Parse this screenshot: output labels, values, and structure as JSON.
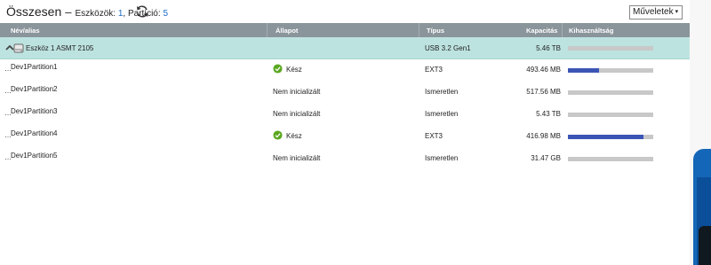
{
  "header": {
    "title": "Összesen",
    "dash": "–",
    "devices_label": "Eszközök:",
    "devices_count": "1",
    "partitions_label": "Partíció:",
    "partitions_count": "5"
  },
  "actions_button": {
    "label": "Műveletek",
    "caret": "▾"
  },
  "columns": {
    "name": "Név/alias",
    "status": "Állapot",
    "type": "Típus",
    "capacity": "Kapacitás",
    "usage": "Kihasználtság"
  },
  "device": {
    "name": "Eszköz 1 ASMT 2105",
    "type": "USB 3.2 Gen1",
    "capacity": "5.46 TB",
    "usage": 0
  },
  "partitions": [
    {
      "name": "Dev1Partition1",
      "status": "Kész",
      "ready": true,
      "type": "EXT3",
      "capacity": "493.46 MB",
      "usage": 0.36
    },
    {
      "name": "Dev1Partition2",
      "status": "Nem inicializált",
      "ready": false,
      "type": "Ismeretlen",
      "capacity": "517.56 MB",
      "usage": 0
    },
    {
      "name": "Dev1Partition3",
      "status": "Nem inicializált",
      "ready": false,
      "type": "Ismeretlen",
      "capacity": "5.43 TB",
      "usage": 0
    },
    {
      "name": "Dev1Partition4",
      "status": "Kész",
      "ready": true,
      "type": "EXT3",
      "capacity": "416.98 MB",
      "usage": 0.89
    },
    {
      "name": "Dev1Partition5",
      "status": "Nem inicializált",
      "ready": false,
      "type": "Ismeretlen",
      "capacity": "31.47 GB",
      "usage": 0
    }
  ],
  "colors": {
    "accent": "#1a6bc4",
    "header_bg": "#8a949b",
    "device_row": "#bde3e0",
    "bar_fill": "#3b55b5",
    "bar_bg": "#c8c8c8",
    "ready_green": "#5aa820"
  },
  "icons": {
    "refresh": "refresh-icon",
    "collapse": "chevron-up-icon",
    "device": "hard-drive-icon",
    "ready": "check-circle-icon"
  }
}
